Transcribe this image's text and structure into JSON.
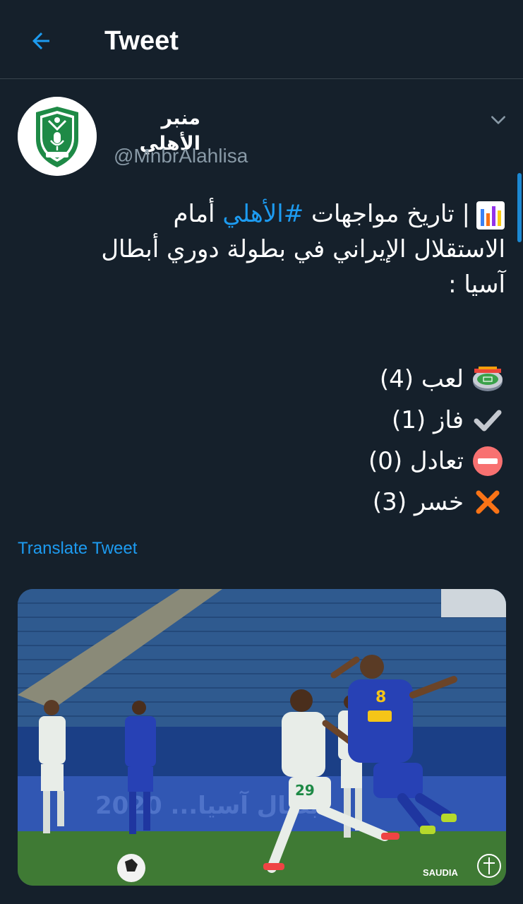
{
  "header": {
    "title": "Tweet",
    "back_icon": "arrow-left-icon"
  },
  "tweet": {
    "author_name": "منبر الأهلي",
    "author_handle": "@MnbrAlahlisa",
    "avatar_icon": "al-ahli-club-logo",
    "menu_icon": "chevron-down-icon",
    "line1_before": "| تاريخ مواجهات ",
    "hashtag": "#الأهلي",
    "line1_after": " أمام",
    "line2": "الاستقلال الإيراني في بطولة دوري أبطال",
    "line3": "آسيا :",
    "stats": [
      {
        "icon": "stadium-icon",
        "text": "لعب (4)"
      },
      {
        "icon": "check-icon",
        "text": "فاز (1)"
      },
      {
        "icon": "no-entry-icon",
        "text": "تعادل (0)"
      },
      {
        "icon": "cross-mark-icon",
        "text": "خسر (3)"
      }
    ],
    "translate_label": "Translate Tweet"
  },
  "media": {
    "kind": "photo",
    "subject": "football-match-photo",
    "pitch_banner": "2020 ...أبطال آسيا",
    "jersey_numbers": [
      "8",
      "29"
    ],
    "sponsor_text": "SAUDIA",
    "colors": {
      "pitch": "#3f7a34",
      "stands": "#2f5a8f",
      "home_kit": "#e8ede8",
      "away_kit": "#2741b5"
    }
  },
  "colors": {
    "background": "#15202b",
    "accent": "#1d9bf0",
    "secondary_text": "#8899a6",
    "divider": "#38444d"
  }
}
